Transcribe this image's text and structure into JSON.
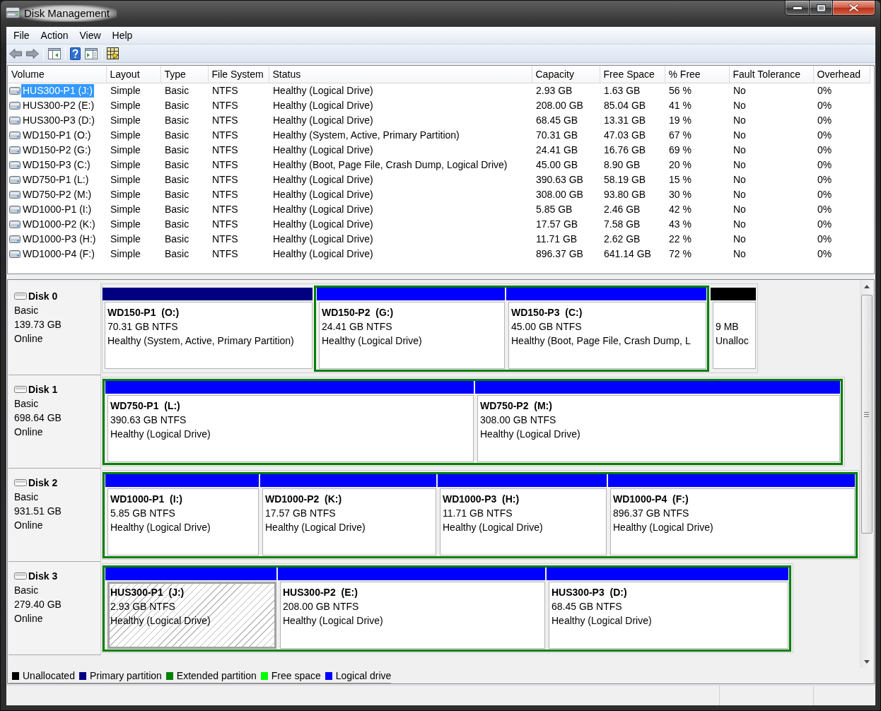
{
  "window": {
    "title": "Disk Management"
  },
  "menu": [
    "File",
    "Action",
    "View",
    "Help"
  ],
  "volume_list": {
    "columns": [
      "Volume",
      "Layout",
      "Type",
      "File System",
      "Status",
      "Capacity",
      "Free Space",
      "% Free",
      "Fault Tolerance",
      "Overhead"
    ],
    "rows": [
      {
        "selected": true,
        "cells": [
          "HUS300-P1 (J:)",
          "Simple",
          "Basic",
          "NTFS",
          "Healthy (Logical Drive)",
          "2.93 GB",
          "1.63 GB",
          "56 %",
          "No",
          "0%"
        ]
      },
      {
        "selected": false,
        "cells": [
          "HUS300-P2 (E:)",
          "Simple",
          "Basic",
          "NTFS",
          "Healthy (Logical Drive)",
          "208.00 GB",
          "85.04 GB",
          "41 %",
          "No",
          "0%"
        ]
      },
      {
        "selected": false,
        "cells": [
          "HUS300-P3 (D:)",
          "Simple",
          "Basic",
          "NTFS",
          "Healthy (Logical Drive)",
          "68.45 GB",
          "13.31 GB",
          "19 %",
          "No",
          "0%"
        ]
      },
      {
        "selected": false,
        "cells": [
          "WD150-P1 (O:)",
          "Simple",
          "Basic",
          "NTFS",
          "Healthy (System, Active, Primary Partition)",
          "70.31 GB",
          "47.03 GB",
          "67 %",
          "No",
          "0%"
        ]
      },
      {
        "selected": false,
        "cells": [
          "WD150-P2 (G:)",
          "Simple",
          "Basic",
          "NTFS",
          "Healthy (Logical Drive)",
          "24.41 GB",
          "16.76 GB",
          "69 %",
          "No",
          "0%"
        ]
      },
      {
        "selected": false,
        "cells": [
          "WD150-P3 (C:)",
          "Simple",
          "Basic",
          "NTFS",
          "Healthy (Boot, Page File, Crash Dump, Logical Drive)",
          "45.00 GB",
          "8.90 GB",
          "20 %",
          "No",
          "0%"
        ]
      },
      {
        "selected": false,
        "cells": [
          "WD750-P1 (L:)",
          "Simple",
          "Basic",
          "NTFS",
          "Healthy (Logical Drive)",
          "390.63 GB",
          "58.19 GB",
          "15 %",
          "No",
          "0%"
        ]
      },
      {
        "selected": false,
        "cells": [
          "WD750-P2 (M:)",
          "Simple",
          "Basic",
          "NTFS",
          "Healthy (Logical Drive)",
          "308.00 GB",
          "93.80 GB",
          "30 %",
          "No",
          "0%"
        ]
      },
      {
        "selected": false,
        "cells": [
          "WD1000-P1 (I:)",
          "Simple",
          "Basic",
          "NTFS",
          "Healthy (Logical Drive)",
          "5.85 GB",
          "2.46 GB",
          "42 %",
          "No",
          "0%"
        ]
      },
      {
        "selected": false,
        "cells": [
          "WD1000-P2 (K:)",
          "Simple",
          "Basic",
          "NTFS",
          "Healthy (Logical Drive)",
          "17.57 GB",
          "7.58 GB",
          "43 %",
          "No",
          "0%"
        ]
      },
      {
        "selected": false,
        "cells": [
          "WD1000-P3 (H:)",
          "Simple",
          "Basic",
          "NTFS",
          "Healthy (Logical Drive)",
          "11.71 GB",
          "2.62 GB",
          "22 %",
          "No",
          "0%"
        ]
      },
      {
        "selected": false,
        "cells": [
          "WD1000-P4 (F:)",
          "Simple",
          "Basic",
          "NTFS",
          "Healthy (Logical Drive)",
          "896.37 GB",
          "641.14 GB",
          "72 %",
          "No",
          "0%"
        ]
      }
    ]
  },
  "disks": [
    {
      "name": "Disk 0",
      "type": "Basic",
      "size": "139.73 GB",
      "status": "Online",
      "partitions": [
        {
          "kind": "primary",
          "label": "WD150-P1  (O:)",
          "size": "70.31 GB NTFS",
          "status": "Healthy (System, Active, Primary Partition)",
          "selected": false
        },
        {
          "kind": "extended",
          "children": [
            {
              "kind": "logical",
              "label": "WD150-P2  (G:)",
              "size": "24.41 GB NTFS",
              "status": "Healthy (Logical Drive)",
              "selected": false
            },
            {
              "kind": "logical",
              "label": "WD150-P3  (C:)",
              "size": "45.00 GB NTFS",
              "status": "Healthy (Boot, Page File, Crash Dump, L",
              "selected": false
            }
          ]
        },
        {
          "kind": "unallocated",
          "size": "9 MB",
          "status": "Unalloc",
          "selected": false
        }
      ]
    },
    {
      "name": "Disk 1",
      "type": "Basic",
      "size": "698.64 GB",
      "status": "Online",
      "partitions": [
        {
          "kind": "extended",
          "children": [
            {
              "kind": "logical",
              "label": "WD750-P1  (L:)",
              "size": "390.63 GB NTFS",
              "status": "Healthy (Logical Drive)",
              "selected": false
            },
            {
              "kind": "logical",
              "label": "WD750-P2  (M:)",
              "size": "308.00 GB NTFS",
              "status": "Healthy (Logical Drive)",
              "selected": false
            }
          ]
        }
      ]
    },
    {
      "name": "Disk 2",
      "type": "Basic",
      "size": "931.51 GB",
      "status": "Online",
      "partitions": [
        {
          "kind": "extended",
          "children": [
            {
              "kind": "logical",
              "label": "WD1000-P1  (I:)",
              "size": "5.85 GB NTFS",
              "status": "Healthy (Logical Drive)",
              "selected": false
            },
            {
              "kind": "logical",
              "label": "WD1000-P2  (K:)",
              "size": "17.57 GB NTFS",
              "status": "Healthy (Logical Drive)",
              "selected": false
            },
            {
              "kind": "logical",
              "label": "WD1000-P3  (H:)",
              "size": "11.71 GB NTFS",
              "status": "Healthy (Logical Drive)",
              "selected": false
            },
            {
              "kind": "logical",
              "label": "WD1000-P4  (F:)",
              "size": "896.37 GB NTFS",
              "status": "Healthy (Logical Drive)",
              "selected": false
            }
          ]
        }
      ]
    },
    {
      "name": "Disk 3",
      "type": "Basic",
      "size": "279.40 GB",
      "status": "Online",
      "partitions": [
        {
          "kind": "extended",
          "children": [
            {
              "kind": "logical",
              "label": "HUS300-P1  (J:)",
              "size": "2.93 GB NTFS",
              "status": "Healthy (Logical Drive)",
              "selected": true
            },
            {
              "kind": "logical",
              "label": "HUS300-P2  (E:)",
              "size": "208.00 GB NTFS",
              "status": "Healthy (Logical Drive)",
              "selected": false
            },
            {
              "kind": "logical",
              "label": "HUS300-P3  (D:)",
              "size": "68.45 GB NTFS",
              "status": "Healthy (Logical Drive)",
              "selected": false
            }
          ]
        }
      ]
    }
  ],
  "legend": [
    {
      "label": "Unallocated",
      "color": "#000000"
    },
    {
      "label": "Primary partition",
      "color": "#000080"
    },
    {
      "label": "Extended partition",
      "color": "#008000"
    },
    {
      "label": "Free space",
      "color": "#00ff00"
    },
    {
      "label": "Logical drive",
      "color": "#0000ff"
    }
  ]
}
